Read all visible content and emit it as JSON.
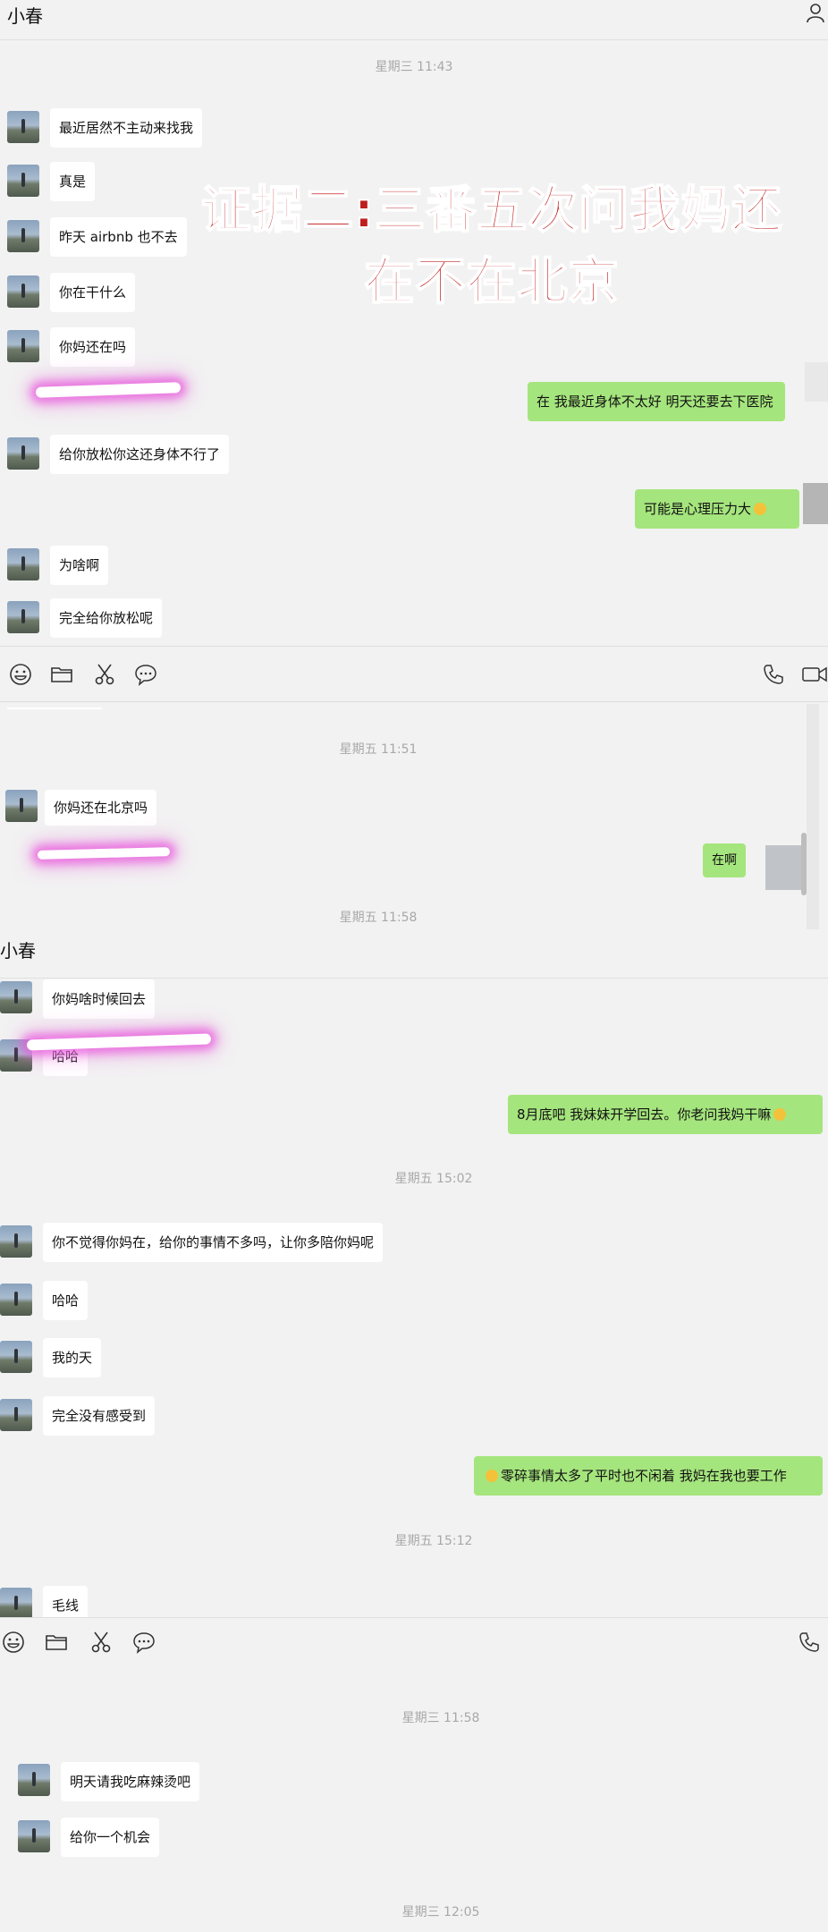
{
  "panel1": {
    "contact": "小春",
    "timestamp": "星期三 11:43",
    "messages": [
      "最近居然不主动来找我",
      "真是",
      "昨天 airbnb 也不去",
      "你在干什么",
      "你妈还在吗",
      "在 我最近身体不太好 明天还要去下医院",
      "给你放松你这还身体不行了",
      "可能是心理压力大",
      "为啥啊",
      "完全给你放松呢"
    ]
  },
  "caption": {
    "line1": "证据二:三番五次问我妈还",
    "line2": "在不在北京"
  },
  "panel2": {
    "timestamp1": "星期五 11:51",
    "messages": [
      "你妈还在北京吗",
      "在啊"
    ],
    "timestamp2": "星期五 11:58"
  },
  "panel3": {
    "contact": "小春",
    "messages_a": [
      "你妈啥时候回去",
      "哈哈",
      "8月底吧 我妹妹开学回去。你老问我妈干嘛"
    ],
    "timestamp1": "星期五 15:02",
    "messages_b": [
      "你不觉得你妈在，给你的事情不多吗，让你多陪你妈呢",
      "哈哈",
      "我的天",
      "完全没有感受到",
      "零碎事情太多了平时也不闲着 我妈在我也要工作"
    ],
    "timestamp2": "星期五 15:12",
    "messages_c": [
      "毛线"
    ],
    "timestamp3": "星期三 11:58",
    "messages_d": [
      "明天请我吃麻辣烫吧",
      "给你一个机会"
    ],
    "timestamp4": "星期三 12:05"
  },
  "icons": [
    "emoji-icon",
    "folder-icon",
    "scissors-icon",
    "chat-history-icon",
    "phone-icon",
    "video-icon",
    "person-icon"
  ],
  "colors": {
    "outgoing_bubble": "#a5e57d",
    "incoming_bubble": "#ffffff",
    "caption": "#bf1f1f",
    "highlight": "#e85cdc"
  }
}
